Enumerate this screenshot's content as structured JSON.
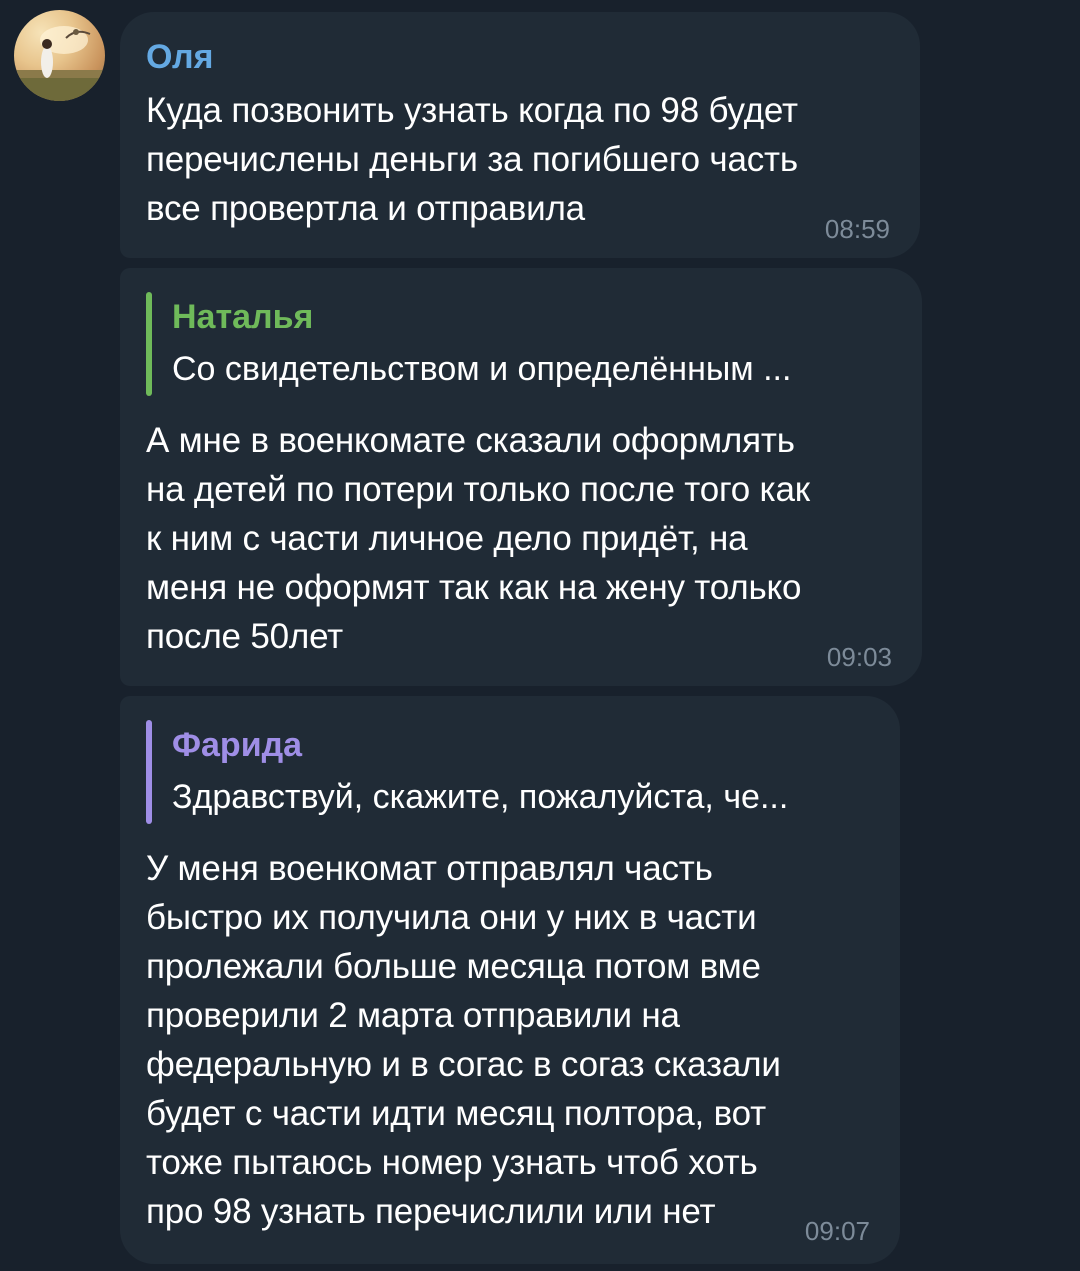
{
  "colors": {
    "background": "#18212c",
    "bubble": "#202b36",
    "sender_name": "#64a9e3",
    "reply_natalya": "#6fba5a",
    "reply_farida": "#9f8ee6",
    "timestamp": "#7d8b99"
  },
  "messages": [
    {
      "sender": "Оля",
      "text": "Куда позвонить узнать когда по 98 будет\nперечислены деньги  за погибшего часть\nвсе провертла и отправила",
      "time": "08:59"
    },
    {
      "reply": {
        "name": "Наталья",
        "text": "Со свидетельством и определённым ..."
      },
      "text": "А мне в военкомате сказали оформлять\nна детей по потери только после того как\nк ним с части личное дело придёт, на\nменя не оформят так как на жену только\nпосле 50лет",
      "time": "09:03"
    },
    {
      "reply": {
        "name": "Фарида",
        "text": "Здравствуй, скажите, пожалуйста, че..."
      },
      "text": "У меня военкомат отправлял часть\nбыстро их получила они у них в части\nпролежали больше месяца потом вме\nпроверили 2 марта отправили на\nфедеральную и в согас в согаз сказали\nбудет с части идти месяц полтора, вот\nтоже пытаюсь номер узнать чтоб хоть\nпро 98 узнать перечислили или нет",
      "time": "09:07"
    }
  ]
}
